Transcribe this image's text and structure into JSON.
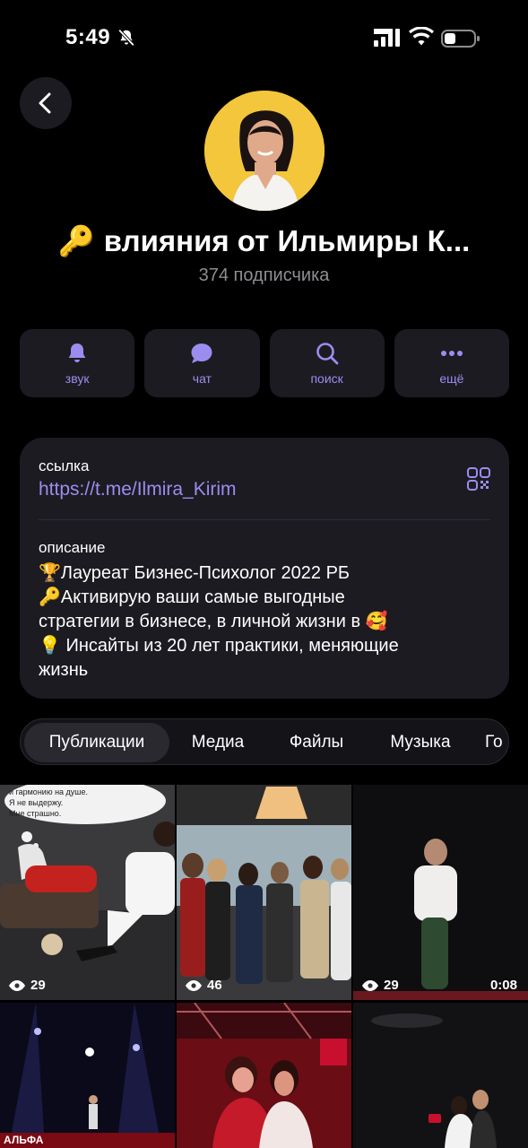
{
  "status": {
    "time": "5:49"
  },
  "channel": {
    "title": "влияния от Ильмиры К...",
    "subscribers": "374 подписчика"
  },
  "actions": [
    {
      "label": "звук",
      "icon": "bell-icon"
    },
    {
      "label": "чат",
      "icon": "chat-bubble-icon"
    },
    {
      "label": "поиск",
      "icon": "search-icon"
    },
    {
      "label": "ещё",
      "icon": "more-dots-icon"
    }
  ],
  "info": {
    "link_label": "ссылка",
    "link_value": "https://t.me/Ilmira_Kirim",
    "description_label": "описание",
    "description_lines": [
      "🏆Лауреат  Бизнес-Психолог 2022 РБ",
      "🔑Активирую ваши самые выгодные",
      "стратегии в бизнесе, в личной жизни в 🥰",
      "💡 Инсайты из 20 лет практики, меняющие",
      "жизнь"
    ]
  },
  "tabs": [
    "Публикации",
    "Медиа",
    "Файлы",
    "Музыка",
    "Го"
  ],
  "grid": {
    "items": [
      {
        "views": "29",
        "caption_lines": [
          "и гармонию на душе.",
          "Я не выдержу.",
          "Мне страшно."
        ]
      },
      {
        "views": "46"
      },
      {
        "views": "29",
        "duration": "0:08"
      },
      {
        "banner": "АЛЬФА"
      },
      {},
      {}
    ]
  },
  "colors": {
    "accent": "#9b8df0",
    "card": "#1c1b21",
    "background": "#000000"
  }
}
